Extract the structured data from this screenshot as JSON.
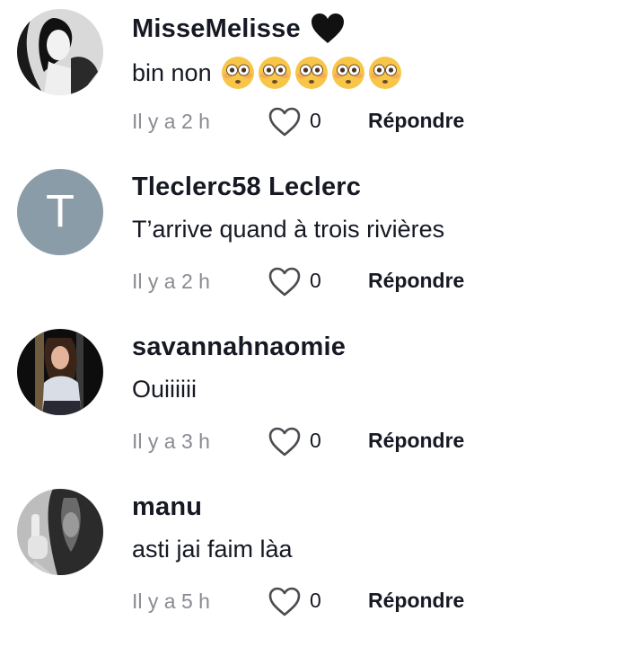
{
  "comments": [
    {
      "username": "MisseMelisse",
      "badge": "black-heart",
      "text": "bin non",
      "emoji_count": 5,
      "emoji": "flushed-face",
      "time": "Il y a 2 h",
      "likes": "0",
      "reply_label": "Répondre",
      "avatar": "photo"
    },
    {
      "username": "Tleclerc58 Leclerc",
      "text": "T’arrive quand à trois rivières",
      "time": "Il y a 2 h",
      "likes": "0",
      "reply_label": "Répondre",
      "avatar_letter": "T",
      "avatar_color": "#8a9ca8"
    },
    {
      "username": "savannahnaomie",
      "text": "Ouiiiiii",
      "time": "Il y a 3 h",
      "likes": "0",
      "reply_label": "Répondre",
      "avatar": "photo"
    },
    {
      "username": "manu",
      "text": "asti jai faim làa",
      "time": "Il y a 5 h",
      "likes": "0",
      "reply_label": "Répondre",
      "avatar": "photo"
    }
  ],
  "colors": {
    "text_primary": "#161823",
    "text_secondary": "#8a8b91",
    "avatar_letter_bg": "#8a9ca8"
  }
}
